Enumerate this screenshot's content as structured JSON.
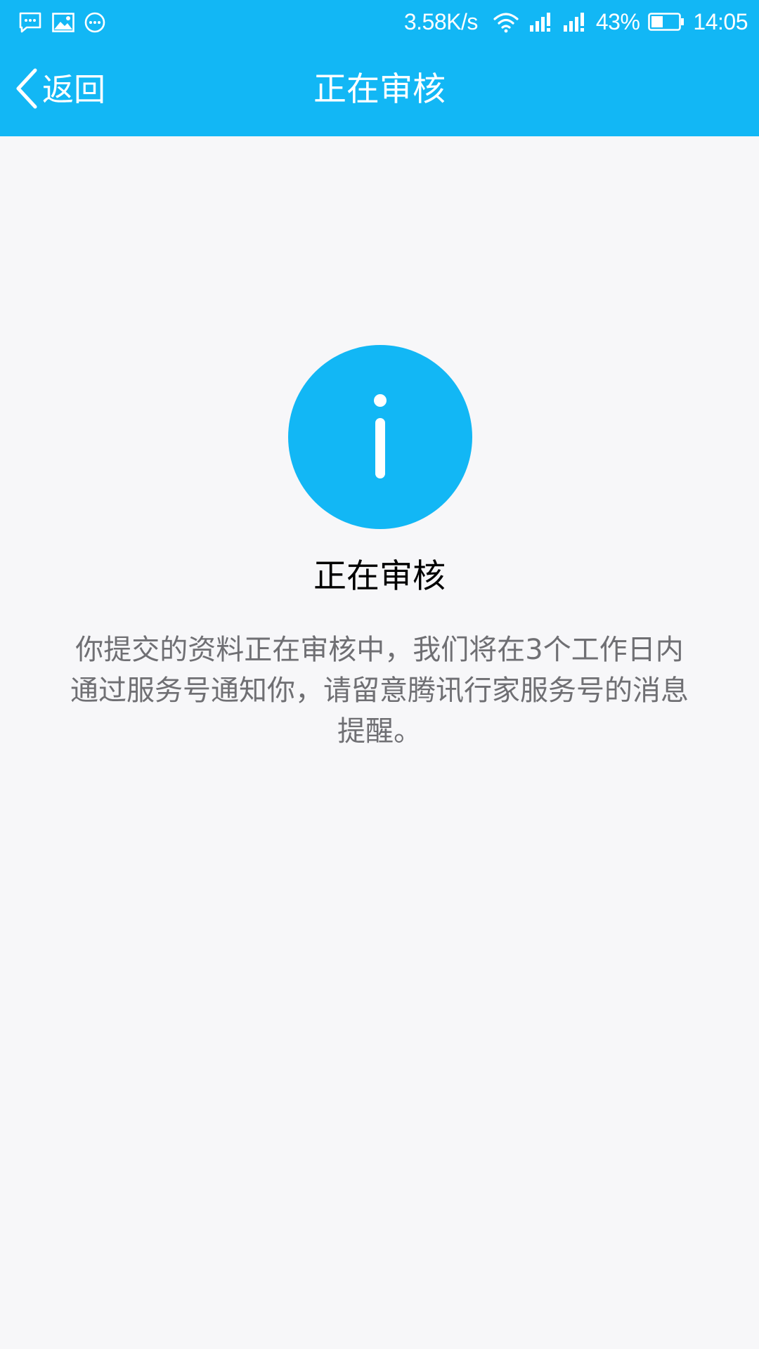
{
  "status_bar": {
    "network_speed": "3.58K/s",
    "battery_percent": "43%",
    "battery_level": 0.43,
    "time": "14:05",
    "left_icons": [
      "message-icon",
      "image-icon",
      "more-dots-icon"
    ],
    "right_icons": [
      "wifi-icon",
      "signal-icon",
      "signal-icon"
    ]
  },
  "nav": {
    "back_label": "返回",
    "title": "正在审核"
  },
  "content": {
    "icon": "info-icon",
    "title": "正在审核",
    "description": "你提交的资料正在审核中，我们将在3个工作日内通过服务号通知你，请留意腾讯行家服务号的消息提醒。"
  },
  "colors": {
    "accent": "#12b7f5",
    "background": "#f7f7f9",
    "title_text": "#000000",
    "desc_text": "#6f6f73"
  }
}
